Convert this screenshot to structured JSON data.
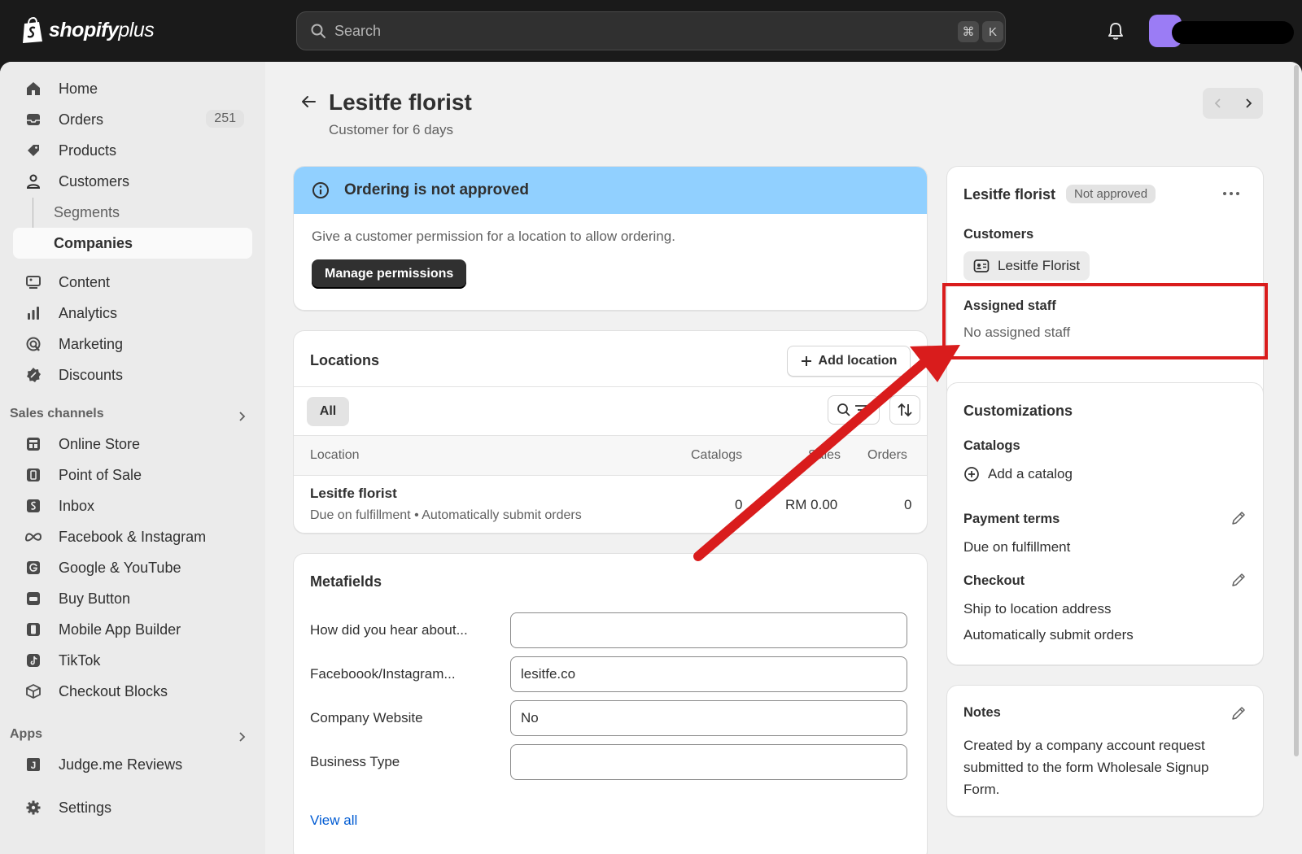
{
  "topbar": {
    "logo_brand": "shopify",
    "logo_suffix": "plus",
    "search_placeholder": "Search",
    "shortcut_mod": "⌘",
    "shortcut_key": "K"
  },
  "sidebar": {
    "items": [
      {
        "label": "Home",
        "icon": "home-icon"
      },
      {
        "label": "Orders",
        "icon": "orders-icon",
        "badge": "251"
      },
      {
        "label": "Products",
        "icon": "tag-icon"
      },
      {
        "label": "Customers",
        "icon": "person-icon"
      },
      {
        "label": "Segments"
      },
      {
        "label": "Companies"
      },
      {
        "label": "Content",
        "icon": "content-icon"
      },
      {
        "label": "Analytics",
        "icon": "bar-chart-icon"
      },
      {
        "label": "Marketing",
        "icon": "target-icon"
      },
      {
        "label": "Discounts",
        "icon": "discount-icon"
      }
    ],
    "sales_channels_label": "Sales channels",
    "channels": [
      {
        "label": "Online Store",
        "icon": "store-icon"
      },
      {
        "label": "Point of Sale",
        "icon": "pos-icon"
      },
      {
        "label": "Inbox",
        "icon": "inbox-icon"
      },
      {
        "label": "Facebook & Instagram",
        "icon": "meta-icon"
      },
      {
        "label": "Google & YouTube",
        "icon": "google-icon"
      },
      {
        "label": "Buy Button",
        "icon": "buy-button-icon"
      },
      {
        "label": "Mobile App Builder",
        "icon": "mobile-icon"
      },
      {
        "label": "TikTok",
        "icon": "tiktok-icon"
      },
      {
        "label": "Checkout Blocks",
        "icon": "box-icon"
      }
    ],
    "apps_label": "Apps",
    "apps": [
      {
        "label": "Judge.me Reviews",
        "icon": "judgeme-icon"
      }
    ],
    "settings_label": "Settings"
  },
  "page": {
    "title": "Lesitfe florist",
    "subtitle": "Customer for 6 days"
  },
  "banner": {
    "title": "Ordering is not approved",
    "body": "Give a customer permission for a location to allow ordering.",
    "button": "Manage permissions"
  },
  "locations": {
    "title": "Locations",
    "add_button": "Add location",
    "filter_all": "All",
    "columns": [
      "Location",
      "Catalogs",
      "Sales",
      "Orders"
    ],
    "row": {
      "name": "Lesitfe florist",
      "detail": "Due on fulfillment • Automatically submit orders",
      "catalogs": "0",
      "sales": "RM 0.00",
      "orders": "0"
    }
  },
  "metafields": {
    "title": "Metafields",
    "fields": [
      {
        "label": "How did you hear about...",
        "value": ""
      },
      {
        "label": "Faceboook/Instagram...",
        "value": "lesitfe.co"
      },
      {
        "label": "Company Website",
        "value": "No"
      },
      {
        "label": "Business Type",
        "value": ""
      }
    ],
    "view_all": "View all"
  },
  "company_card": {
    "name": "Lesitfe florist",
    "status": "Not approved",
    "customers_label": "Customers",
    "customer_chip": "Lesitfe Florist",
    "assigned_staff_label": "Assigned staff",
    "assigned_staff_value": "No assigned staff"
  },
  "customizations": {
    "title": "Customizations",
    "catalogs_label": "Catalogs",
    "add_catalog": "Add a catalog",
    "payment_terms_label": "Payment terms",
    "payment_terms_value": "Due on fulfillment",
    "checkout_label": "Checkout",
    "checkout_line1": "Ship to location address",
    "checkout_line2": "Automatically submit orders"
  },
  "notes": {
    "title": "Notes",
    "body": "Created by a company account request submitted to the form Wholesale Signup Form."
  },
  "colors": {
    "banner_bg": "#91d0ff",
    "annotation_red": "#d91c1c",
    "avatar": "#9b7cf5"
  }
}
